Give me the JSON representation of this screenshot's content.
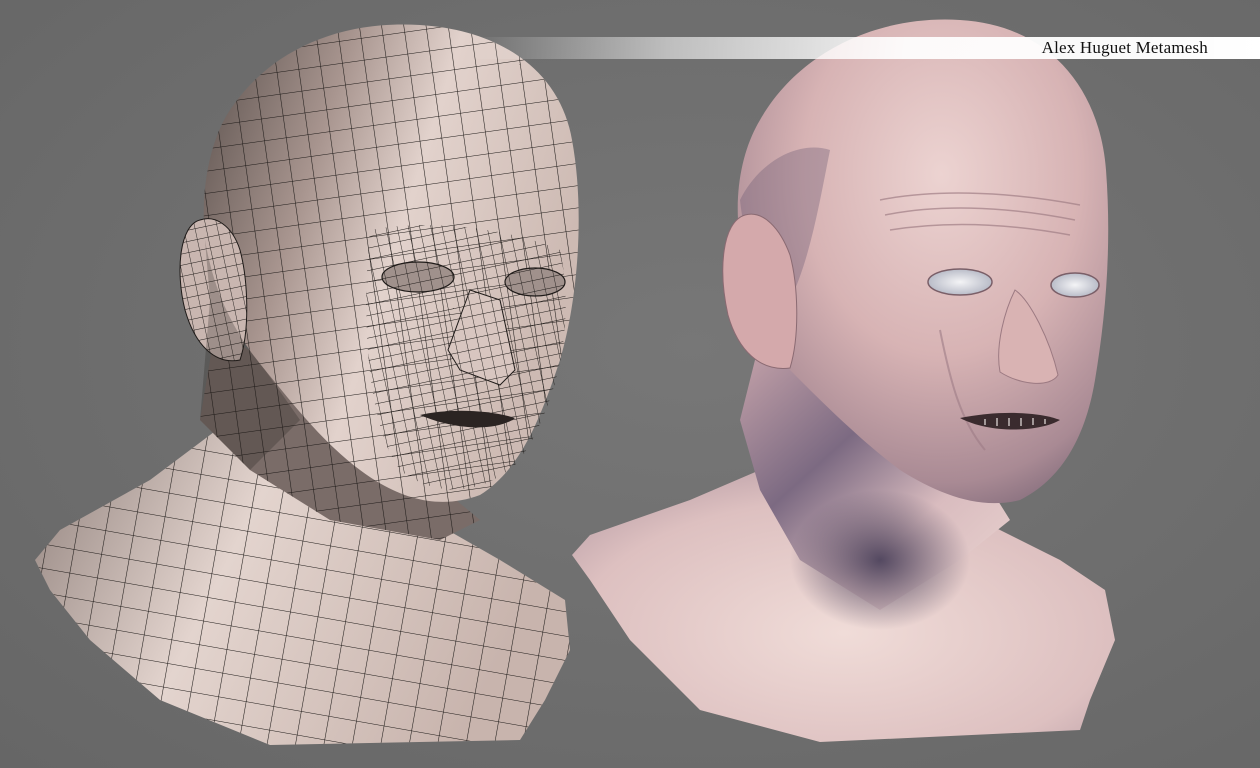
{
  "title": "Alex Huguet Metamesh",
  "images": {
    "wireframe": {
      "description_icon": "wireframe-head-bust"
    },
    "sculpt": {
      "description_icon": "sculpted-head-bust"
    }
  },
  "colors": {
    "background": "#6f6f6f",
    "wire_skin": "#d9c9c3",
    "wire_line": "#1e1a18",
    "sculpt_skin": "#d8b6b8",
    "sculpt_shadow": "#5a4e66"
  }
}
